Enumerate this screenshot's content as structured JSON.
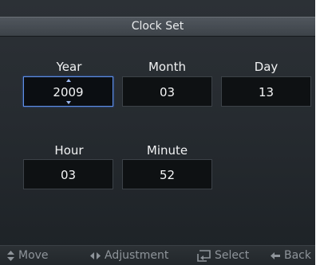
{
  "title": "Clock Set",
  "fields": {
    "year": {
      "label": "Year",
      "value": "2009"
    },
    "month": {
      "label": "Month",
      "value": "03"
    },
    "day": {
      "label": "Day",
      "value": "13"
    },
    "hour": {
      "label": "Hour",
      "value": "03"
    },
    "minute": {
      "label": "Minute",
      "value": "52"
    }
  },
  "active_field": "year",
  "footer": {
    "move": "Move",
    "adjustment": "Adjustment",
    "select": "Select",
    "back": "Back"
  },
  "icons": {
    "move": "up-down-arrows-icon",
    "adjustment": "left-right-arrows-icon",
    "select": "enter-icon",
    "back": "back-arrow-icon"
  },
  "colors": {
    "active_border": "#5f8fe8",
    "background": "#262b30",
    "footer_text": "#8e949a"
  }
}
